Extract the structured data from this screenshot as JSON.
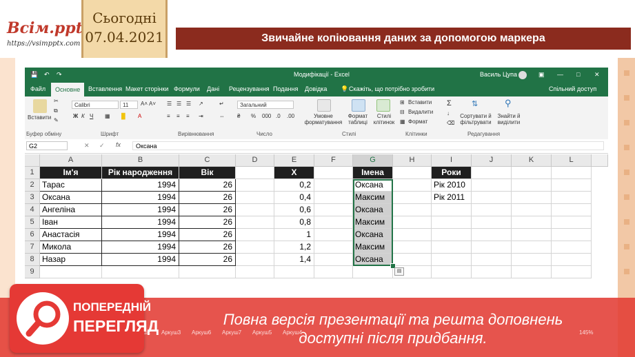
{
  "slide": {
    "logo_title": "Всім.pptx",
    "logo_url": "https://vsimpptx.com",
    "date_label": "Сьогодні",
    "date_value": "07.04.2021",
    "title": "Звичайне копіювання даних за допомогою маркера"
  },
  "excel": {
    "window_title": "Модифікації - Excel",
    "user_name": "Василь Цупа",
    "tabs": [
      "Файл",
      "Основне",
      "Вставлення",
      "Макет сторінки",
      "Формули",
      "Дані",
      "Рецензування",
      "Подання",
      "Довідка"
    ],
    "active_tab": "Основне",
    "tell_me": "Скажіть, що потрібно зробити",
    "share": "Спільний доступ",
    "ribbon": {
      "paste": "Вставити",
      "font_name": "Calibri",
      "font_size": "11",
      "number_format": "Загальний",
      "conditional": "Умовне форматування",
      "format_table": "Формат таблиці",
      "cell_styles": "Стилі клітинок",
      "insert": "Вставити",
      "delete": "Видалити",
      "format": "Формат",
      "sort_filter": "Сортувати й фільтрувати",
      "find_select": "Знайти й виділити",
      "groups": [
        "Буфер обміну",
        "Шрифт",
        "Вирівнювання",
        "Число",
        "Стилі",
        "Клітинки",
        "Редагування"
      ]
    },
    "name_box": "G2",
    "formula_value": "Оксана",
    "columns": [
      "A",
      "B",
      "C",
      "D",
      "E",
      "F",
      "G",
      "H",
      "I",
      "J",
      "K",
      "L"
    ],
    "rows": [
      "1",
      "2",
      "3",
      "4",
      "5",
      "6",
      "7",
      "8",
      "9"
    ],
    "table_headers": {
      "A": "Ім'я",
      "B": "Рік народження",
      "C": "Вік",
      "E": "X",
      "G": "Імена",
      "I": "Роки"
    },
    "names": [
      "Тарас",
      "Оксана",
      "Ангеліна",
      "Іван",
      "Анастасія",
      "Микола",
      "Назар"
    ],
    "years": [
      "1994",
      "1994",
      "1994",
      "1994",
      "1994",
      "1994",
      "1994"
    ],
    "ages": [
      "26",
      "26",
      "26",
      "26",
      "26",
      "26",
      "26"
    ],
    "x_values": [
      "0,2",
      "0,4",
      "0,6",
      "0,8",
      "1",
      "1,2",
      "1,4"
    ],
    "copied_names": [
      "Оксана",
      "Максим",
      "Оксана",
      "Максим",
      "Оксана",
      "Максим",
      "Оксана"
    ],
    "years_list": [
      "Рік 2010",
      "Рік 2011"
    ],
    "sheets": [
      "Аркуш2",
      "Аркуш3",
      "Аркуш6",
      "Аркуш7",
      "Аркуш5",
      "Аркуш4"
    ],
    "zoom": "145%"
  },
  "preview": {
    "badge_line1": "ПОПЕРЕДНІЙ",
    "badge_line2": "ПЕРЕГЛЯД",
    "text_line1": "Повна версія презентації та решта доповнень",
    "text_line2": "доступні після придбання."
  },
  "colors": {
    "excel_green": "#217346",
    "title_bar": "#8b2b1e",
    "banner_red": "#e23c34"
  }
}
